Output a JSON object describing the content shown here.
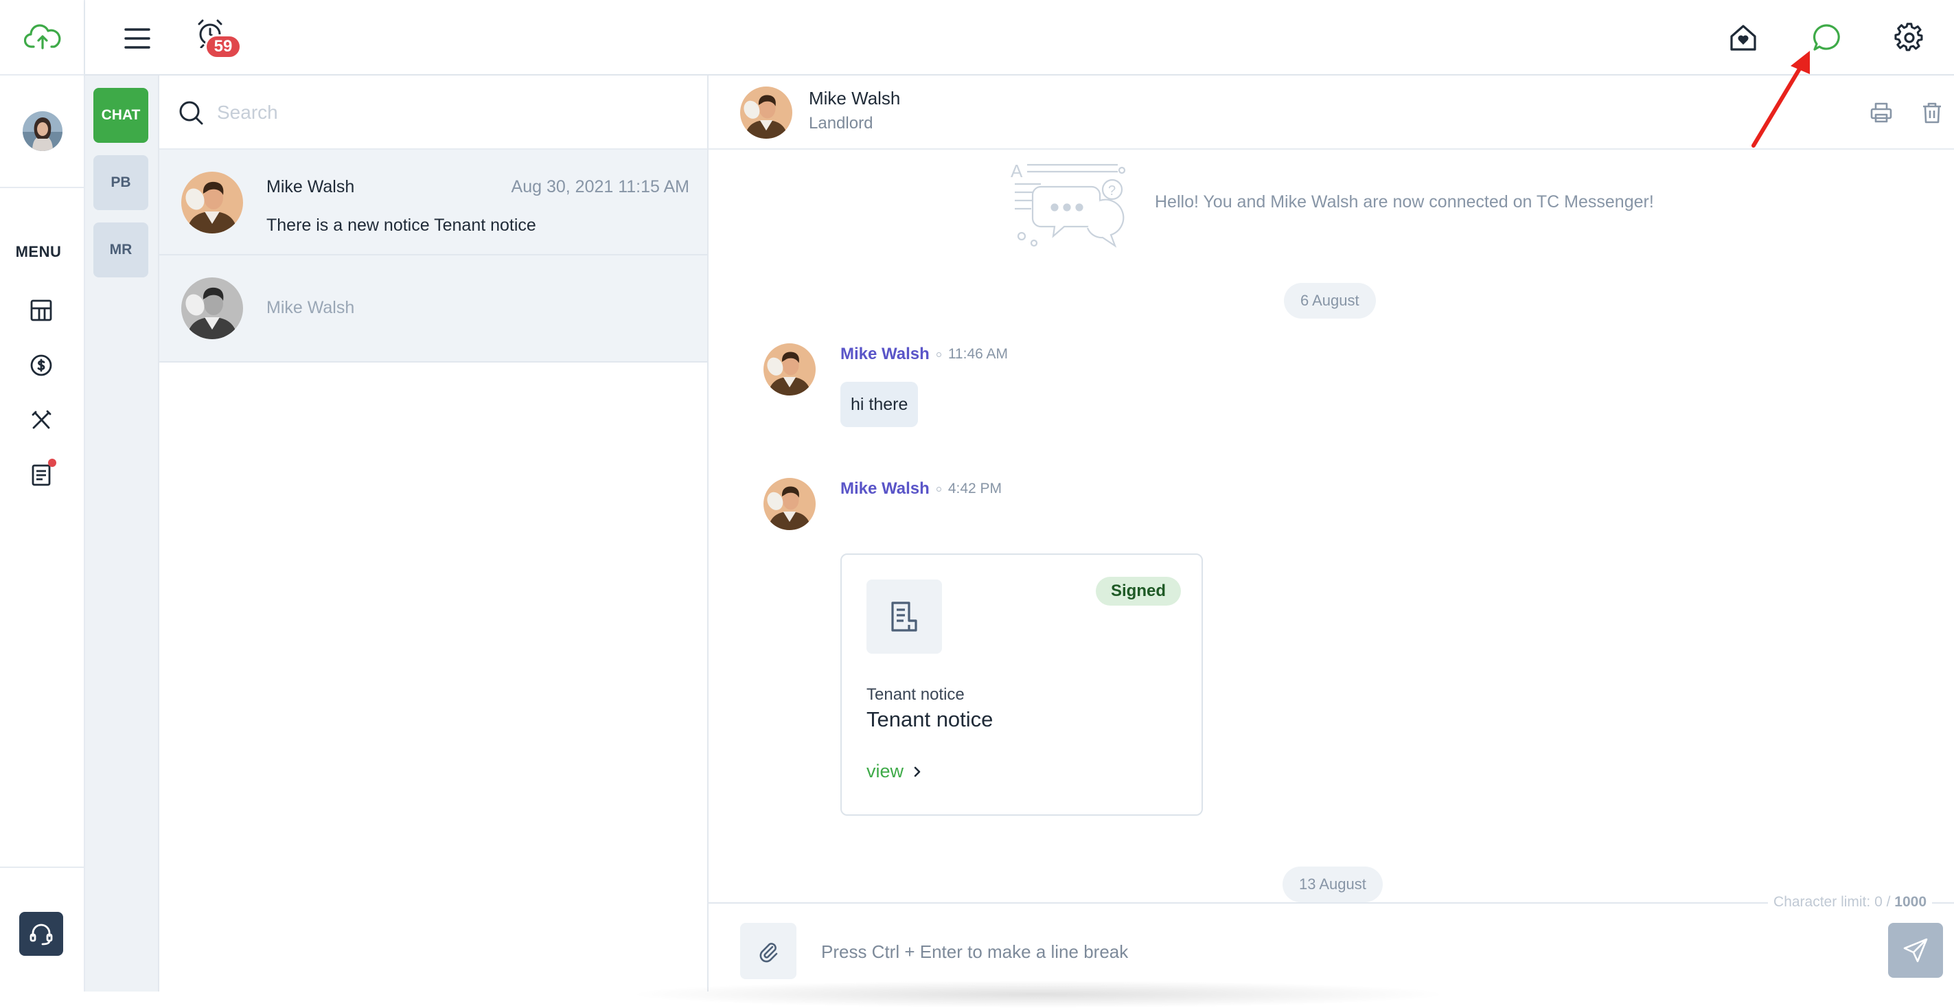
{
  "app": {
    "logo_icon": "cloud-upload-icon",
    "accent_color": "#3eaa48"
  },
  "rail": {
    "menu_label": "MENU",
    "items": [
      {
        "icon": "dashboard-icon"
      },
      {
        "icon": "dollar-icon"
      },
      {
        "icon": "tools-icon"
      },
      {
        "icon": "document-icon",
        "has_notification": true
      }
    ],
    "support_icon": "headset-icon"
  },
  "header": {
    "menu_icon": "hamburger-icon",
    "alarm_icon": "alarm-clock-icon",
    "alarm_count": "59",
    "right_icons": [
      "home-heart-icon",
      "chat-bubble-icon",
      "gear-icon"
    ]
  },
  "tabs": [
    {
      "label": "CHAT",
      "active": true
    },
    {
      "label": "PB",
      "active": false
    },
    {
      "label": "MR",
      "active": false
    }
  ],
  "search": {
    "placeholder": "Search"
  },
  "conversations": [
    {
      "name": "Mike Walsh",
      "time": "Aug 30, 2021 11:15 AM",
      "preview": "There is a new notice Tenant notice"
    },
    {
      "name": "Mike Walsh",
      "time": "",
      "preview": ""
    }
  ],
  "chat": {
    "contact_name": "Mike Walsh",
    "contact_role": "Landlord",
    "welcome": "Hello! You and Mike Walsh are now connected on TC Messenger!",
    "date_1": "6 August",
    "date_2": "13 August",
    "messages": [
      {
        "sender": "Mike Walsh",
        "time": "11:46 AM",
        "text": "hi there"
      },
      {
        "sender": "Mike Walsh",
        "time": "4:42 PM",
        "document": {
          "status": "Signed",
          "type": "Tenant notice",
          "title": "Tenant notice",
          "link": "view"
        }
      }
    ],
    "composer": {
      "placeholder": "Press Ctrl + Enter to make a line break",
      "char_limit_label": "Character limit:",
      "char_count": "0",
      "char_max": "1000"
    }
  }
}
